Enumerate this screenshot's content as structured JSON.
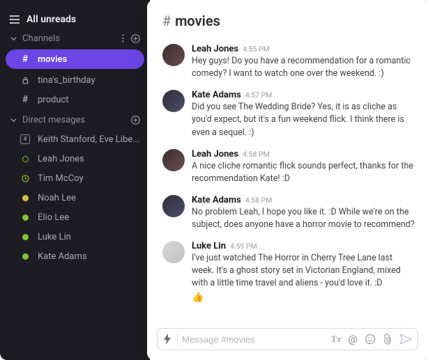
{
  "sidebar": {
    "header_title": "All unreads",
    "channels_label": "Channels",
    "dm_label": "Direct mesages",
    "channels": [
      {
        "name": "movies",
        "type": "hash",
        "active": true
      },
      {
        "name": "tina's_birthday",
        "type": "lock",
        "active": false
      },
      {
        "name": "product",
        "type": "hash",
        "active": false
      }
    ],
    "dms": [
      {
        "name": "Keith Stanford, Eve Libe...",
        "icon": "count",
        "count": "4"
      },
      {
        "name": "Leah Jones",
        "icon": "away"
      },
      {
        "name": "Tim McCoy",
        "icon": "clock"
      },
      {
        "name": "Noah Lee",
        "icon": "yellow"
      },
      {
        "name": "Elio Lee",
        "icon": "online"
      },
      {
        "name": "Luke Lin",
        "icon": "online"
      },
      {
        "name": "Kate Adams",
        "icon": "online"
      }
    ]
  },
  "channel": {
    "name": "movies",
    "composer_placeholder": "Message #movies"
  },
  "messages": [
    {
      "author": "Leah Jones",
      "time": "4:55 PM",
      "avatar": "a1",
      "text": "Hey guys! Do you have a recommendation for a romantic comedy? I want to watch one over the weekend. :)"
    },
    {
      "author": "Kate Adams",
      "time": "4:57 PM",
      "avatar": "a2",
      "text": "Did you see The Wedding Bride? Yes, it is as cliche as you'd expect, but it's a fun weekend flick. I think there is even a sequel. :)"
    },
    {
      "author": "Leah Jones",
      "time": "4:58 PM",
      "avatar": "a1",
      "text": "A nice cliche romantic flick sounds perfect, thanks for the recommendation Kate! :D"
    },
    {
      "author": "Kate Adams",
      "time": "4:58 PM",
      "avatar": "a2",
      "text": "No problem Leah, I hope you like it. :D While we're on the subject, does anyone have a horror movie to recommend?"
    },
    {
      "author": "Luke Lin",
      "time": "4:59 PM",
      "avatar": "a3",
      "text": "I've just watched The Horror in Cherry Tree Lane last week. It's a ghost story set in Victorian England, mixed with a little time travel and aliens - you'd love it. :D",
      "reaction": "👍"
    }
  ]
}
